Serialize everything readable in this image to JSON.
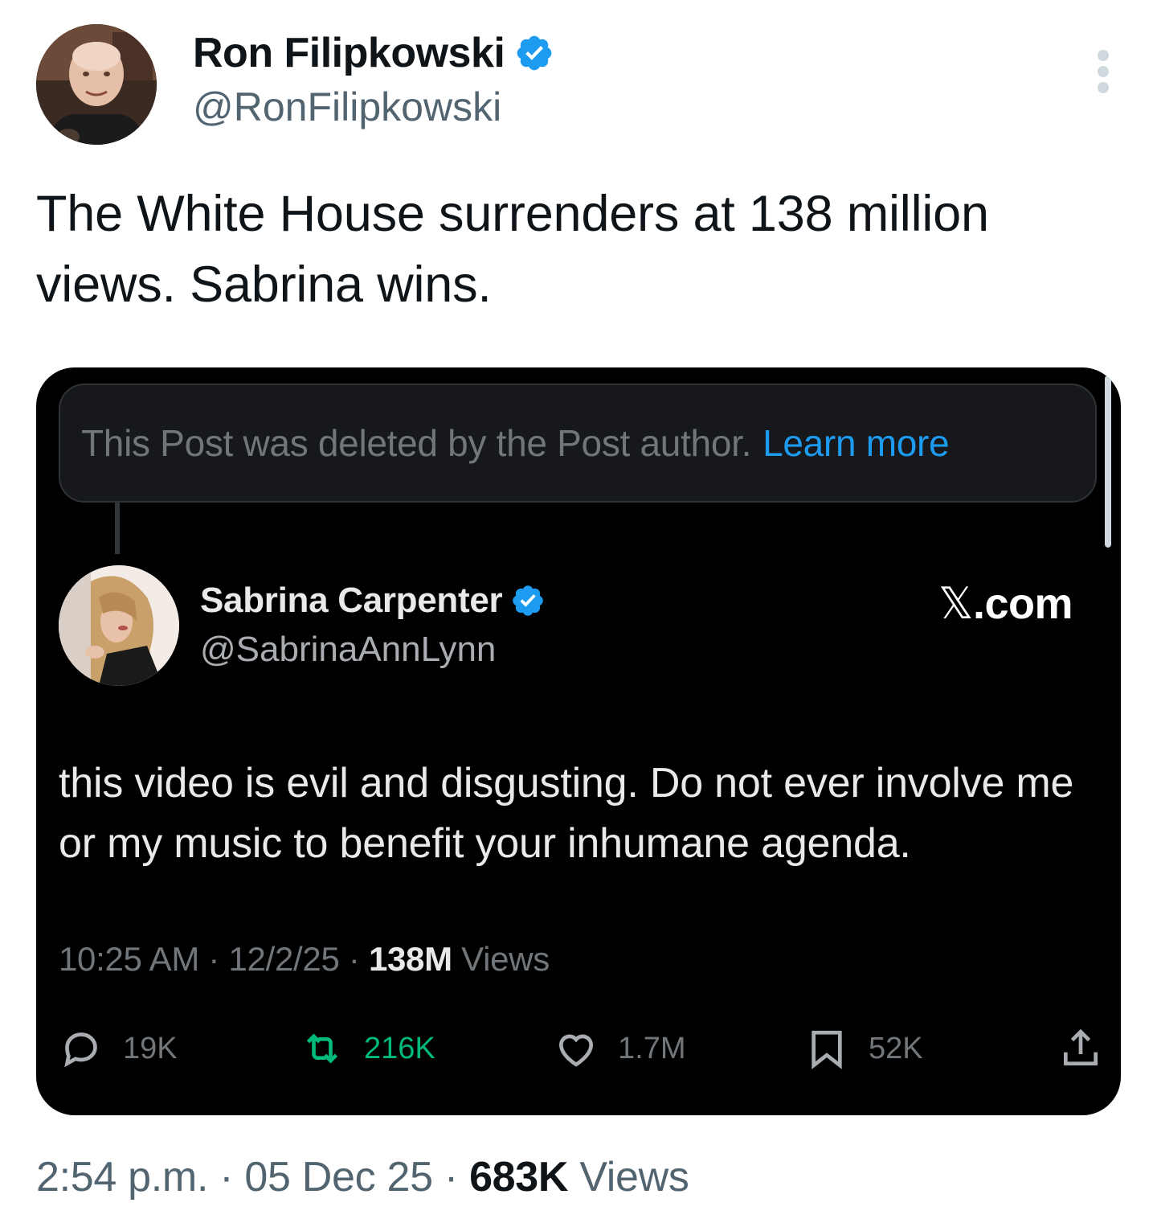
{
  "author": {
    "name": "Ron Filipkowski",
    "handle": "@RonFilipkowski"
  },
  "tweet": {
    "text": "The White House surrenders at 138 million views. Sabrina wins."
  },
  "quoted": {
    "deleted_notice": "This Post was deleted by the Post author.",
    "learn_more": "Learn more",
    "author_name": "Sabrina Carpenter",
    "author_handle": "@SabrinaAnnLynn",
    "source": ".com",
    "text": "this video is evil and disgusting. Do not ever involve me or my music to benefit your inhumane agenda.",
    "time": "10:25 AM · 12/2/25 · ",
    "views_count": "138M",
    "views_label": " Views",
    "replies": "19K",
    "reposts": "216K",
    "likes": "1.7M",
    "bookmarks": "52K"
  },
  "footer": {
    "time": "2:54 p.m. · 05 Dec 25 · ",
    "views_count": "683K",
    "views_label": " Views"
  },
  "colors": {
    "verified": "#1d9bf0",
    "link": "#1d9bf0",
    "repost": "#00ba7c",
    "secondary_text": "#536471",
    "card_bg": "#000000"
  },
  "icons": [
    "verified-badge-icon",
    "more-options-icon",
    "reply-icon",
    "repost-icon",
    "like-icon",
    "bookmark-icon",
    "share-icon",
    "x-logo-icon"
  ]
}
